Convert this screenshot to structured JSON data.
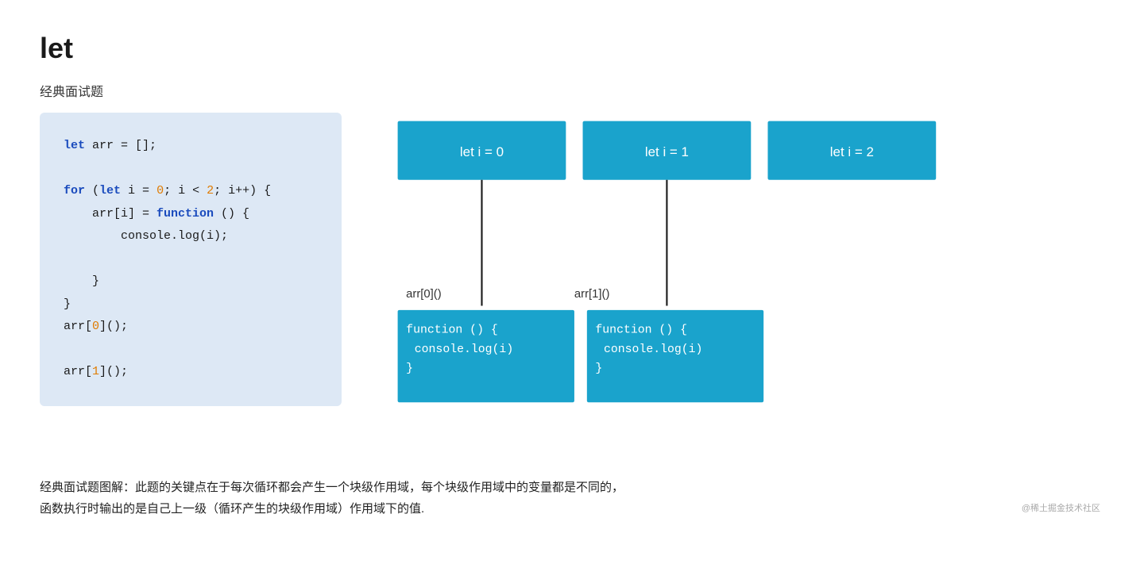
{
  "page": {
    "title": "let",
    "section_label": "经典面试题",
    "description_line1": "经典面试题图解：此题的关键点在于每次循环都会产生一个块级作用域，每个块级作用域中的变量都是不同的，",
    "description_line2": "函数执行时输出的是自己上一级（循环产生的块级作用域）作用域下的值.",
    "watermark": "@稀土掘金技术社区"
  },
  "code": {
    "lines": [
      "let arr = [];",
      "",
      "for (let i = 0; i < 2; i++) {",
      "    arr[i] = function () {",
      "        console.log(i);",
      "",
      "    }",
      "}",
      "arr[0]();",
      "",
      "arr[1]();"
    ]
  },
  "diagram": {
    "boxes_top": [
      "let i = 0",
      "let i = 1",
      "let i = 2"
    ],
    "labels_mid": [
      "arr[0]()",
      "arr[1]()"
    ],
    "boxes_bottom": [
      {
        "line1": "function () {",
        "line2": "  console.log(i)",
        "line3": "}"
      },
      {
        "line1": "function () {",
        "line2": "  console.log(i)",
        "line3": "}"
      }
    ]
  }
}
